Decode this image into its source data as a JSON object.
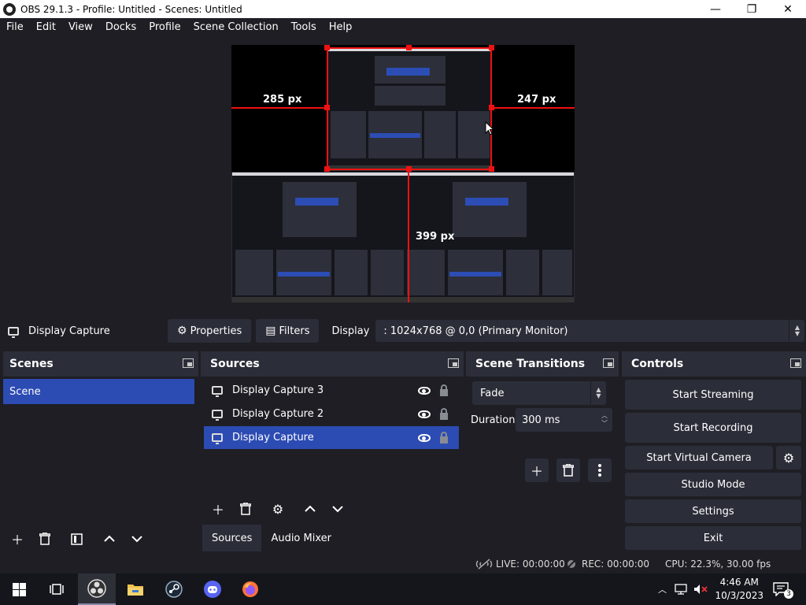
{
  "window": {
    "title": "OBS 29.1.3 - Profile: Untitled - Scenes: Untitled",
    "minimize": "—",
    "maximize": "❐",
    "close": "✕"
  },
  "menu": [
    "File",
    "Edit",
    "View",
    "Docks",
    "Profile",
    "Scene Collection",
    "Tools",
    "Help"
  ],
  "preview": {
    "left_gap": "285 px",
    "right_gap": "247 px",
    "bottom_gap": "399 px"
  },
  "source_toolbar": {
    "selected_source": "Display Capture",
    "properties": "Properties",
    "filters": "Filters",
    "display_label": "Display",
    "display_value": ": 1024x768 @ 0,0 (Primary Monitor)"
  },
  "scenes": {
    "title": "Scenes",
    "items": [
      "Scene"
    ]
  },
  "sources": {
    "title": "Sources",
    "items": [
      {
        "label": "Display Capture 3",
        "selected": false
      },
      {
        "label": "Display Capture 2",
        "selected": false
      },
      {
        "label": "Display Capture",
        "selected": true
      }
    ],
    "tabs": [
      "Sources",
      "Audio Mixer"
    ]
  },
  "transitions": {
    "title": "Scene Transitions",
    "selected": "Fade",
    "duration_label": "Duration",
    "duration_value": "300 ms"
  },
  "controls": {
    "title": "Controls",
    "start_streaming": "Start Streaming",
    "start_recording": "Start Recording",
    "start_virtual_camera": "Start Virtual Camera",
    "studio_mode": "Studio Mode",
    "settings": "Settings",
    "exit": "Exit"
  },
  "status": {
    "live": "LIVE: 00:00:00",
    "rec": "REC: 00:00:00",
    "cpu": "CPU: 22.3%, 30.00 fps"
  },
  "taskbar": {
    "time": "4:46 AM",
    "date": "10/3/2023",
    "notifications": "3"
  },
  "colors": {
    "accent": "#2c4bb3",
    "panel": "#2b2e38",
    "background": "#1e1e24",
    "guide": "#ee1111"
  }
}
